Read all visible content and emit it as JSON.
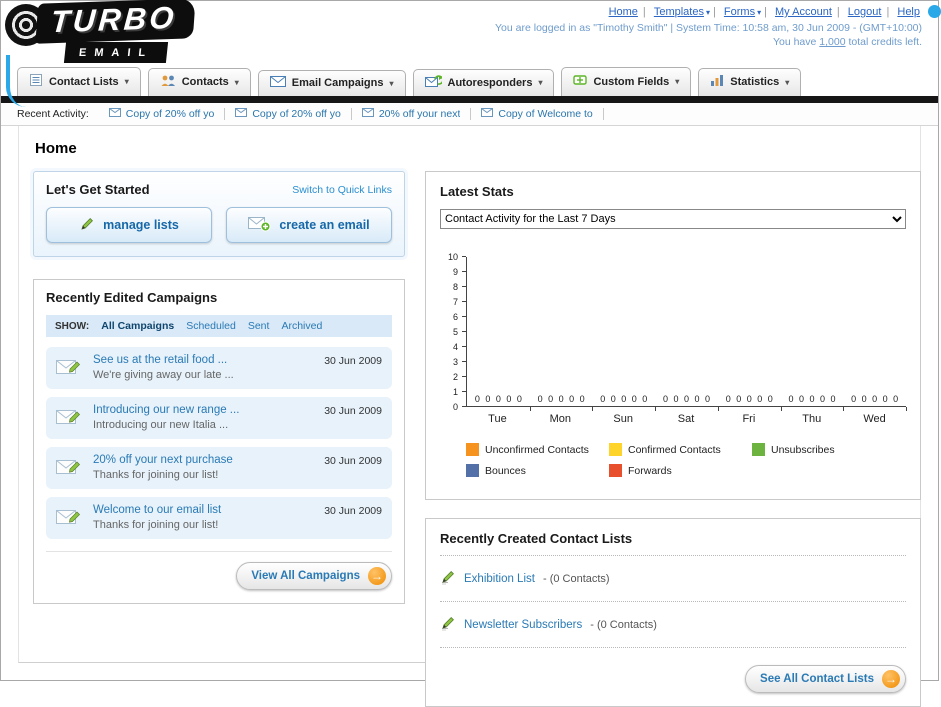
{
  "page_title": "Home",
  "icons": {
    "caret": "▾",
    "arrow_right": "→"
  },
  "header": {
    "logo": {
      "title": "TURBO",
      "subtitle": "EMAIL"
    },
    "links": [
      {
        "label": "Home",
        "dropdown": false
      },
      {
        "label": "Templates",
        "dropdown": true
      },
      {
        "label": "Forms",
        "dropdown": true
      },
      {
        "label": "My Account",
        "dropdown": false
      },
      {
        "label": "Logout",
        "dropdown": false
      },
      {
        "label": "Help",
        "dropdown": false
      }
    ],
    "session_line": "You are logged in as \"Timothy Smith\" | System Time: 10:58 am, 30 Jun 2009 - (GMT+10:00)",
    "credits": {
      "prefix": "You have",
      "amount": "1,000",
      "suffix": "total credits left."
    }
  },
  "nav": {
    "tabs": [
      {
        "label": "Contact Lists"
      },
      {
        "label": "Contacts"
      },
      {
        "label": "Email Campaigns"
      },
      {
        "label": "Autoresponders"
      },
      {
        "label": "Custom Fields"
      },
      {
        "label": "Statistics"
      }
    ]
  },
  "recent_activity": {
    "label": "Recent Activity:",
    "items": [
      "Copy of 20% off yo",
      "Copy of 20% off yo",
      "20% off your next",
      "Copy of Welcome to"
    ]
  },
  "get_started": {
    "title": "Let's Get Started",
    "quick_links": "Switch to Quick Links",
    "manage_lists": "manage lists",
    "create_email": "create an email"
  },
  "campaigns": {
    "title": "Recently Edited Campaigns",
    "show_label": "SHOW:",
    "filters": [
      "All Campaigns",
      "Scheduled",
      "Sent",
      "Archived"
    ],
    "items": [
      {
        "title": "See us at the retail food ...",
        "subtitle": "We're giving away our late ...",
        "date": "30 Jun 2009"
      },
      {
        "title": "Introducing our new range ...",
        "subtitle": "Introducing our new Italia ...",
        "date": "30 Jun 2009"
      },
      {
        "title": "20% off your next purchase",
        "subtitle": "Thanks for joining our list!",
        "date": "30 Jun 2009"
      },
      {
        "title": "Welcome to our email list",
        "subtitle": "Thanks for joining our list!",
        "date": "30 Jun 2009"
      }
    ],
    "view_all_label": "View All Campaigns"
  },
  "stats": {
    "title": "Latest Stats",
    "dropdown_value": "Contact Activity for the Last 7 Days",
    "chart_data": {
      "type": "bar",
      "title": "Contact Activity for the Last 7 Days",
      "categories": [
        "Tue",
        "Mon",
        "Sun",
        "Sat",
        "Fri",
        "Thu",
        "Wed"
      ],
      "series": [
        {
          "name": "Unconfirmed Contacts",
          "color": "#f6921e",
          "values": [
            0,
            0,
            0,
            0,
            0,
            0,
            0
          ]
        },
        {
          "name": "Confirmed Contacts",
          "color": "#ffd42a",
          "values": [
            0,
            0,
            0,
            0,
            0,
            0,
            0
          ]
        },
        {
          "name": "Unsubscribes",
          "color": "#6cb33f",
          "values": [
            0,
            0,
            0,
            0,
            0,
            0,
            0
          ]
        },
        {
          "name": "Bounces",
          "color": "#5470a8",
          "values": [
            0,
            0,
            0,
            0,
            0,
            0,
            0
          ]
        },
        {
          "name": "Forwards",
          "color": "#e8502d",
          "values": [
            0,
            0,
            0,
            0,
            0,
            0,
            0
          ]
        }
      ],
      "xlabel": "",
      "ylabel": "",
      "ylim": [
        0,
        10
      ],
      "grid": false,
      "legend_position": "bottom"
    }
  },
  "contact_lists": {
    "title": "Recently Created Contact Lists",
    "items": [
      {
        "name": "Exhibition List",
        "detail": "- (0 Contacts)"
      },
      {
        "name": "Newsletter Subscribers",
        "detail": "- (0 Contacts)"
      }
    ],
    "see_all_label": "See All Contact Lists"
  }
}
